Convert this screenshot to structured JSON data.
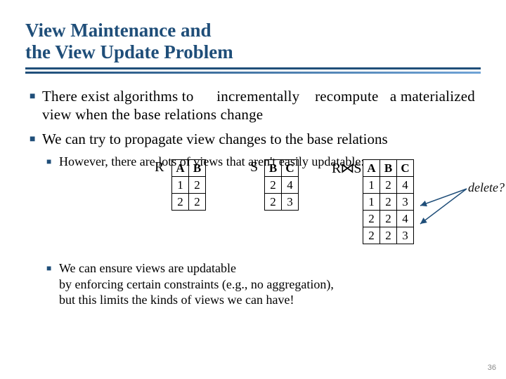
{
  "title_line1": "View Maintenance and",
  "title_line2": "the View Update Problem",
  "bullets": {
    "b1a": "There exist algorithms to      incrementally    recompute   a materialized view when the base relations change",
    "b1b": "We can try to propagate view changes to the base relations",
    "b2a": "However, there are lots of views that aren't easily updatable:",
    "b2b": "We can ensure views are updatable\nby enforcing certain constraints (e.g., no aggregation),\nbut this limits the kinds of views we can have!"
  },
  "tables": {
    "R": {
      "label": "R",
      "headers": [
        "A",
        "B"
      ],
      "rows": [
        [
          "1",
          "2"
        ],
        [
          "2",
          "2"
        ]
      ]
    },
    "S": {
      "label": "S",
      "headers": [
        "B",
        "C"
      ],
      "rows": [
        [
          "2",
          "4"
        ],
        [
          "2",
          "3"
        ]
      ]
    },
    "J": {
      "label": "R⋈S",
      "headers": [
        "A",
        "B",
        "C"
      ],
      "rows": [
        [
          "1",
          "2",
          "4"
        ],
        [
          "1",
          "2",
          "3"
        ],
        [
          "2",
          "2",
          "4"
        ],
        [
          "2",
          "2",
          "3"
        ]
      ]
    }
  },
  "annotations": {
    "delete": "delete?"
  },
  "page_number": "36"
}
